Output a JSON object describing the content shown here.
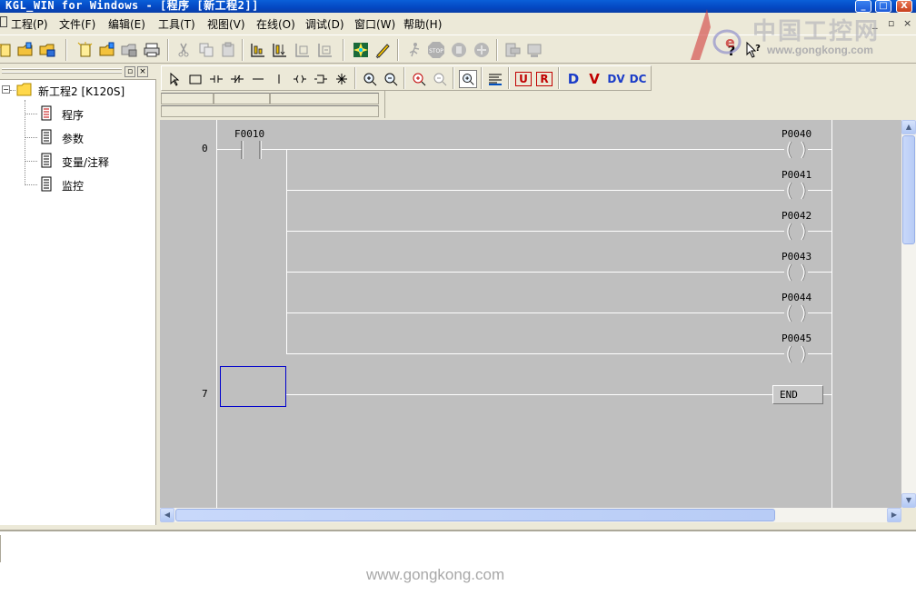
{
  "window": {
    "title": "KGL_WIN for Windows - [程序 [新工程2]]",
    "controls": [
      "_",
      "□",
      "X"
    ]
  },
  "menu": [
    {
      "label": "工程(P)"
    },
    {
      "label": "文件(F)"
    },
    {
      "label": "编辑(E)"
    },
    {
      "label": "工具(T)"
    },
    {
      "label": "视图(V)"
    },
    {
      "label": "在线(O)"
    },
    {
      "label": "调试(D)"
    },
    {
      "label": "窗口(W)"
    },
    {
      "label": "帮助(H)"
    }
  ],
  "mdi_controls": [
    "_",
    "▫",
    "×"
  ],
  "watermark": {
    "cn": "中国工控网",
    "url": "www.gongkong.com",
    "bottom": "www.gongkong.com"
  },
  "project_tree": {
    "root": "新工程2 [K120S]",
    "children": [
      "程序",
      "参数",
      "变量/注释",
      "监控"
    ]
  },
  "ladder_toolbar": {
    "icons": [
      "select-arrow",
      "rectangle",
      "no-contact",
      "nc-contact",
      "horizontal-line",
      "vertical-line",
      "coil",
      "function-block",
      "wildcard",
      "zoom-in",
      "zoom-out",
      "zoom-in-2",
      "zoom-out-2",
      "zoom-fit",
      "align",
      "U",
      "R",
      "D",
      "V",
      "Dv",
      "Dc"
    ],
    "text_labels": {
      "u": "U",
      "r": "R",
      "d": "D",
      "v": "V",
      "dv": "DV",
      "dc": "DC"
    }
  },
  "ladder": {
    "rungs": [
      {
        "number": "0",
        "contact": "F0010",
        "coils": [
          "P0040",
          "P0041",
          "P0042",
          "P0043",
          "P0044",
          "P0045"
        ]
      },
      {
        "number": "7",
        "end_label": "END"
      }
    ]
  },
  "colors": {
    "canvas_bg": "#bfbfbf",
    "cursor": "#0000cc",
    "titlebar": "#0447c2"
  }
}
